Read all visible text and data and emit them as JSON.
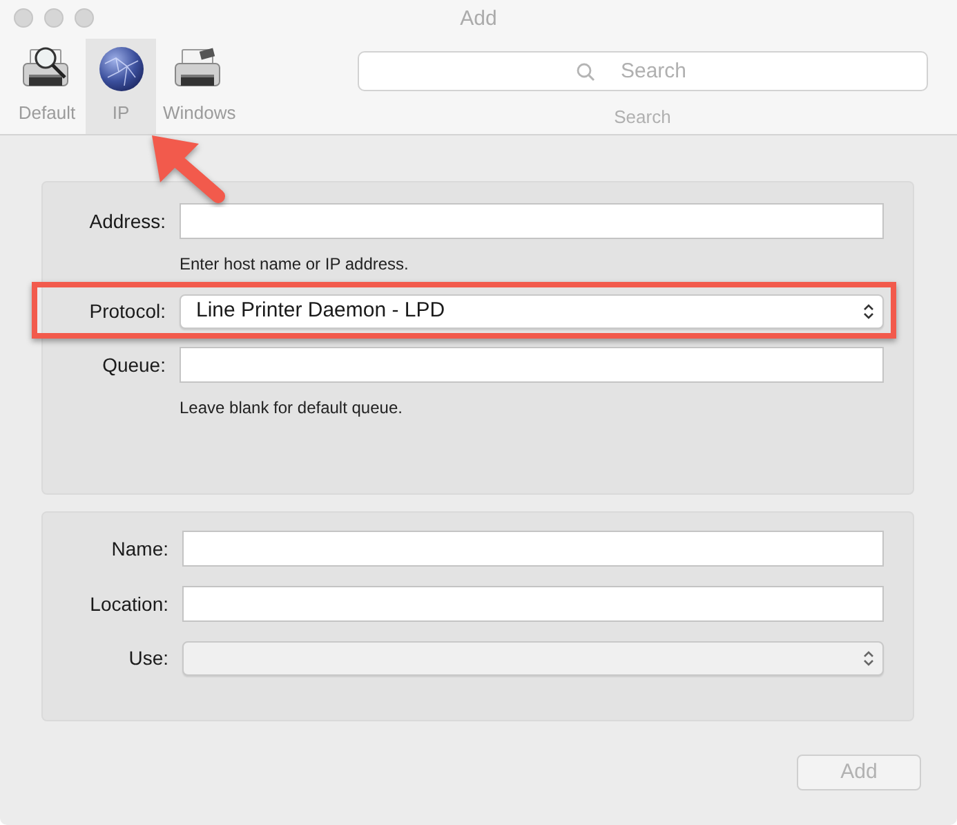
{
  "window": {
    "title": "Add"
  },
  "pointer_arrow": true,
  "toolbar": {
    "tabs": [
      {
        "label": "Default",
        "kind": "default",
        "selected": false
      },
      {
        "label": "IP",
        "kind": "ip",
        "selected": true
      },
      {
        "label": "Windows",
        "kind": "windows",
        "selected": false
      }
    ],
    "search": {
      "placeholder": "Search",
      "label": "Search"
    }
  },
  "connection_panel": {
    "fields": [
      {
        "label": "Address:",
        "kind": "text",
        "hint": "Enter host name or IP address.",
        "highlighted": false,
        "disabled": false
      },
      {
        "label": "Protocol:",
        "kind": "popup",
        "value": "Line Printer Daemon - LPD",
        "highlighted": true,
        "disabled": false
      },
      {
        "label": "Queue:",
        "kind": "text",
        "hint": "Leave blank for default queue.",
        "highlighted": false,
        "disabled": false
      }
    ]
  },
  "details_panel": {
    "fields": [
      {
        "label": "Name:",
        "kind": "text",
        "highlighted": false,
        "disabled": false
      },
      {
        "label": "Location:",
        "kind": "text",
        "highlighted": false,
        "disabled": false
      },
      {
        "label": "Use:",
        "kind": "popup",
        "highlighted": false,
        "disabled": true
      }
    ]
  },
  "add_button": {
    "label": "Add",
    "disabled": true
  }
}
